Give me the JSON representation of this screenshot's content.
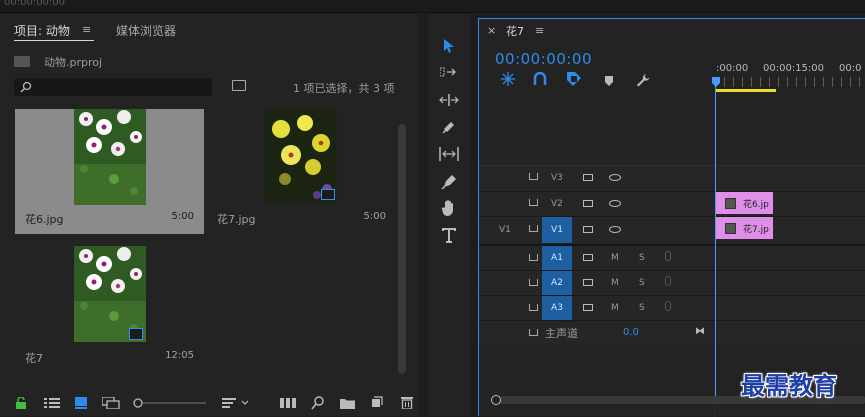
{
  "top": {
    "timecode": "00:00:00:00"
  },
  "project": {
    "tab_active": "项目: 动物",
    "tab_menu": "≡",
    "tab_media": "媒体浏览器",
    "file_name": "动物.prproj",
    "search_placeholder": "",
    "selection_text": "1 项已选择，共 3 项",
    "items": [
      {
        "name": "花6.jpg",
        "duration": "5:00"
      },
      {
        "name": "花7.jpg",
        "duration": "5:00"
      },
      {
        "name": "花7",
        "duration": "12:05"
      }
    ]
  },
  "timeline": {
    "close": "×",
    "tab_title": "花7",
    "tab_menu": "≡",
    "timecode": "00:00:00:00",
    "ruler_start": ":00:00",
    "ruler_mid": "00:00:15:00",
    "ruler_end": "00:0",
    "tracks_video": [
      {
        "label": "V3",
        "src": ""
      },
      {
        "label": "V2",
        "src": ""
      },
      {
        "label": "V1",
        "src": "V1"
      }
    ],
    "tracks_audio": [
      "A1",
      "A2",
      "A3"
    ],
    "mute_label": "M",
    "solo_label": "S",
    "master_label": "主声道",
    "master_value": "0.0",
    "clips": [
      {
        "label": "花6.jp"
      },
      {
        "label": "花7.jp"
      }
    ]
  },
  "watermark": "最需教育",
  "colors": {
    "accent_blue": "#2d8ceb",
    "clip_pink": "#e08fe8",
    "target_blue": "#1d5fa0",
    "playhead": "#4a9bff"
  }
}
